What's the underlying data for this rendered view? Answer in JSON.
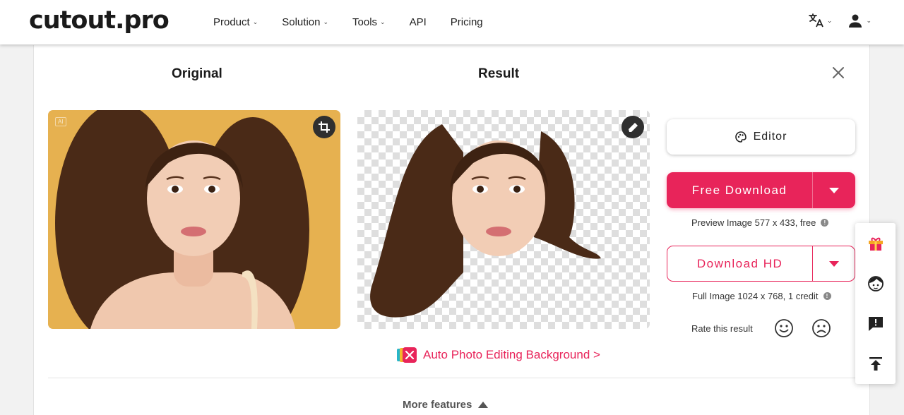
{
  "brand": {
    "logo_text": "cutout.pro"
  },
  "nav": {
    "items": [
      {
        "label": "Product",
        "has_dropdown": true
      },
      {
        "label": "Solution",
        "has_dropdown": true
      },
      {
        "label": "Tools",
        "has_dropdown": true
      },
      {
        "label": "API",
        "has_dropdown": false
      },
      {
        "label": "Pricing",
        "has_dropdown": false
      }
    ]
  },
  "header_right": {
    "icons": [
      "translate-icon",
      "user-icon"
    ]
  },
  "panel": {
    "original_title": "Original",
    "result_title": "Result",
    "original_badge": "AI"
  },
  "actions": {
    "editor_label": "Editor",
    "free_download_label": "Free Download",
    "preview_note": "Preview Image 577 x 433, free",
    "download_hd_label": "Download HD",
    "full_note": "Full Image 1024 x 768, 1 credit",
    "rate_label": "Rate this result"
  },
  "promo": {
    "label": "Auto Photo Editing Background >"
  },
  "more_features": {
    "label": "More features"
  },
  "floating_bar": {
    "icons": [
      "gift-icon",
      "support-avatar-icon",
      "feedback-icon",
      "back-to-top-icon"
    ]
  },
  "colors": {
    "accent": "#e8245a",
    "original_bg": "#e6b150",
    "dark_icon_bg": "#2f2f2f",
    "text_dark": "#1a1a1a"
  }
}
